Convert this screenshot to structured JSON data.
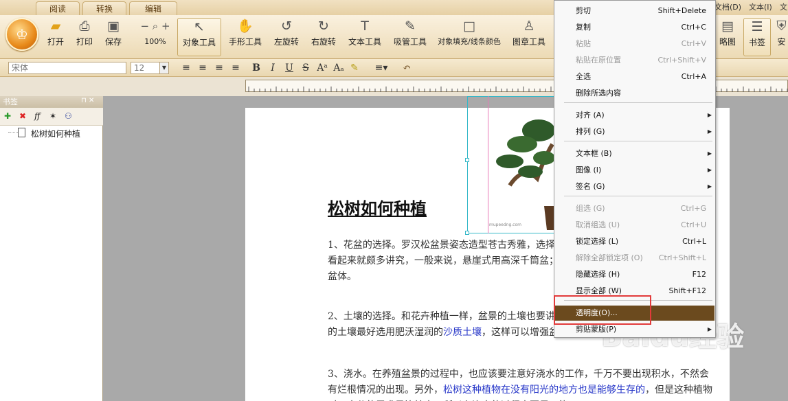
{
  "tabs": [
    "阅读",
    "转换",
    "编辑"
  ],
  "toolbar": {
    "buttons": [
      "打开",
      "打印",
      "保存"
    ],
    "zoom": "100%",
    "tools": [
      "对象工具",
      "手形工具",
      "左旋转",
      "右旋转",
      "文本工具",
      "吸管工具",
      "对象填充/线条颜色",
      "图章工具"
    ],
    "right_tools": [
      "略图",
      "书签"
    ],
    "right_partial": "安"
  },
  "format": {
    "font_name": "宋体",
    "font_size": "12"
  },
  "menubar_right": [
    "文档(D)",
    "文本(I)",
    "文"
  ],
  "bookmarks": {
    "title": "书签",
    "items": [
      "松树如何种植"
    ]
  },
  "document": {
    "title": "松树如何种植",
    "image_caption": "mupeedng.com",
    "para1": "1、花盆的选择。罗汉松盆景姿态造型苍古秀雅，选择上可以选用紫砂陶盆或釉陶盆，这样看起来就颇多讲究，一般来说，悬崖式用高深千筒盆；斜干式圆盆；提根式、附石式用较浅盆体。",
    "para2_a": "2、土壤的选择。和花卉种植一样，盆景的土壤也要讲究，罗汉松盆景种植的话，那么我们的土壤最好选用肥沃湿润的",
    "para2_b": "沙质土壤",
    "para2_c": "，这样可以增强盆景的排水性。",
    "para3_a": "3、浇水。在养殖盆景的过程中，也应该要注意好浇水的工作，千万不要出现积水，不然会有烂根情况的出现。另外，",
    "para3_b": "松树这种植物在没有阳光的地方也是能够生存的",
    "para3_c": "，但是这种植物对于水分的需求是比较大，所以在浇水的过程中要尽可能"
  },
  "context_menu": {
    "items": [
      {
        "label": "剪切",
        "shortcut": "Shift+Delete",
        "enabled": true
      },
      {
        "label": "复制",
        "shortcut": "Ctrl+C",
        "enabled": true
      },
      {
        "label": "粘贴",
        "shortcut": "Ctrl+V",
        "enabled": false
      },
      {
        "label": "粘贴在原位置",
        "shortcut": "Ctrl+Shift+V",
        "enabled": false
      },
      {
        "label": "全选",
        "shortcut": "Ctrl+A",
        "enabled": true
      },
      {
        "label": "删除所选内容",
        "shortcut": "",
        "enabled": true
      },
      {
        "label": "对齐 (A)",
        "shortcut": "",
        "enabled": true,
        "submenu": true
      },
      {
        "label": "排列 (G)",
        "shortcut": "",
        "enabled": true,
        "submenu": true
      },
      {
        "label": "文本框 (B)",
        "shortcut": "",
        "enabled": true,
        "submenu": true
      },
      {
        "label": "图像 (I)",
        "shortcut": "",
        "enabled": true,
        "submenu": true
      },
      {
        "label": "签名 (G)",
        "shortcut": "",
        "enabled": true,
        "submenu": true
      },
      {
        "label": "组选 (G)",
        "shortcut": "Ctrl+G",
        "enabled": false
      },
      {
        "label": "取消组选 (U)",
        "shortcut": "Ctrl+U",
        "enabled": false
      },
      {
        "label": "锁定选择 (L)",
        "shortcut": "Ctrl+L",
        "enabled": true
      },
      {
        "label": "解除全部锁定项 (O)",
        "shortcut": "Ctrl+Shift+L",
        "enabled": false
      },
      {
        "label": "隐藏选择 (H)",
        "shortcut": "F12",
        "enabled": true
      },
      {
        "label": "显示全部 (W)",
        "shortcut": "Shift+F12",
        "enabled": true
      },
      {
        "label": "透明度(O)...",
        "shortcut": "",
        "enabled": true,
        "highlighted": true
      },
      {
        "label": "剪贴蒙版(P)",
        "shortcut": "",
        "enabled": true,
        "submenu": true
      }
    ]
  },
  "watermark": "Baidu经验",
  "colors": {
    "highlight": "#6b4a1e",
    "red_box": "#e23a3a",
    "link_blue": "#2636c8"
  }
}
